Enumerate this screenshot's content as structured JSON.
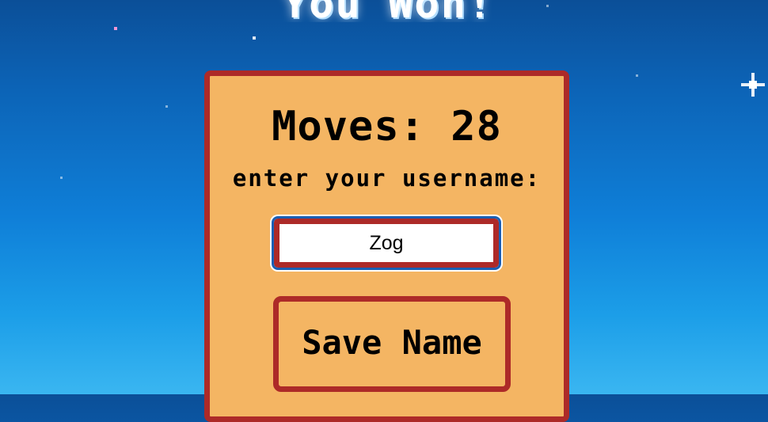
{
  "screen": {
    "title": "You Won!",
    "background_top": "#0b4f98",
    "background_bottom": "#3ab6f1"
  },
  "panel": {
    "moves_label": "Moves: 28",
    "moves_count": 28,
    "prompt": "enter your username:",
    "username_value": "Zog",
    "save_label": "Save Name",
    "fill_color": "#f4b563",
    "border_color": "#ad2a28"
  },
  "decor": {
    "star_icon": "sparkle-icon"
  }
}
